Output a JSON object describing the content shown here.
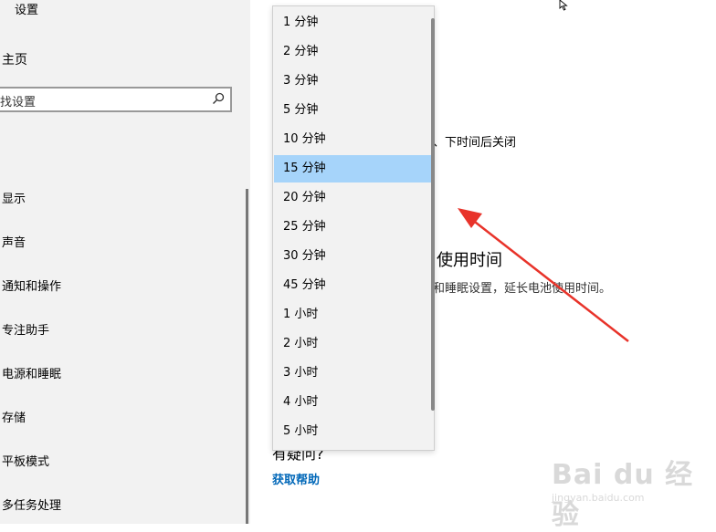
{
  "sidebar": {
    "title": "设置",
    "home_label": "主页",
    "search_placeholder": "找设置",
    "items": [
      {
        "label": "显示"
      },
      {
        "label": "声音"
      },
      {
        "label": "通知和操作"
      },
      {
        "label": "专注助手"
      },
      {
        "label": "电源和睡眠"
      },
      {
        "label": "存储"
      },
      {
        "label": "平板模式"
      },
      {
        "label": "多任务处理"
      }
    ]
  },
  "main": {
    "partial_text": "、下时间后关闭",
    "section_heading": "使用时间",
    "section_desc": "和睡眠设置，延长电池使用时间。",
    "help_heading": "有疑问?",
    "help_link": "获取帮助"
  },
  "dropdown": {
    "selected": "15 分钟",
    "options": [
      "1 分钟",
      "2 分钟",
      "3 分钟",
      "5 分钟",
      "10 分钟",
      "15 分钟",
      "20 分钟",
      "25 分钟",
      "30 分钟",
      "45 分钟",
      "1 小时",
      "2 小时",
      "3 小时",
      "4 小时",
      "5 小时"
    ]
  },
  "annotation": {
    "arrow_color": "#e8332a"
  },
  "watermark": {
    "logo": "Bai du 经验",
    "url": "jingyan.baidu.com"
  }
}
